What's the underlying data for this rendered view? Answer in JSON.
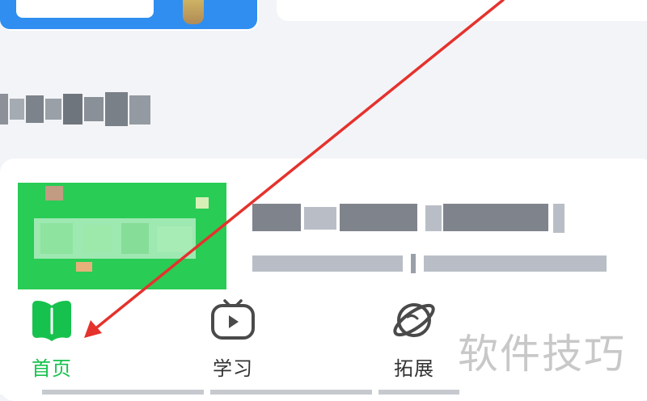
{
  "tabs": [
    {
      "label": "首页",
      "icon": "home-book-icon",
      "active": true
    },
    {
      "label": "学习",
      "icon": "study-play-icon",
      "active": false
    },
    {
      "label": "拓展",
      "icon": "planet-icon",
      "active": false
    }
  ],
  "watermark": {
    "text": "软件技巧"
  },
  "colors": {
    "accent_green": "#16c24d",
    "annotation_red": "#e5322d",
    "thumb_green": "#29cc55",
    "blue_card": "#2f8ef0"
  }
}
